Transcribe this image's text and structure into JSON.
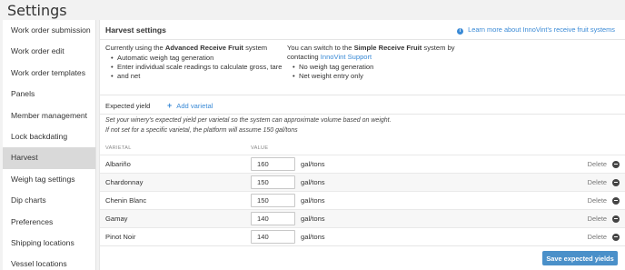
{
  "page_title": "Settings",
  "sidebar": {
    "items": [
      {
        "label": "Work order submission"
      },
      {
        "label": "Work order edit"
      },
      {
        "label": "Work order templates"
      },
      {
        "label": "Panels"
      },
      {
        "label": "Member management"
      },
      {
        "label": "Lock backdating"
      },
      {
        "label": "Harvest",
        "active": true
      },
      {
        "label": "Weigh tag settings"
      },
      {
        "label": "Dip charts"
      },
      {
        "label": "Preferences"
      },
      {
        "label": "Shipping locations"
      },
      {
        "label": "Vessel locations"
      }
    ]
  },
  "main": {
    "title": "Harvest settings",
    "learn_link": "Learn more about InnoVint's receive fruit systems",
    "current": {
      "prefix": "Currently using the ",
      "system": "Advanced Receive Fruit",
      "suffix": " system",
      "bullets": [
        "Automatic weigh tag generation",
        "Enter individual scale readings to calculate gross, tare",
        "and net"
      ]
    },
    "switch": {
      "prefix": "You can switch to the ",
      "system": "Simple Receive Fruit",
      "suffix": " system by",
      "line2_prefix": "contacting ",
      "support_link": "InnoVint Support",
      "bullets": [
        "No weigh tag generation",
        "Net weight entry only"
      ]
    },
    "expected_yield": "Expected yield",
    "add_varietal": "Add varietal",
    "add_icon": "+",
    "note_line1": "Set your winery's expected yield per varietal so the system can approximate volume based on weight.",
    "note_line2": "If not set for a specific varietal, the platform will assume 150 gal/tons",
    "col_varietal": "VARIETAL",
    "col_value": "VALUE",
    "rows": [
      {
        "name": "Albariño",
        "value": "160",
        "unit": "gal/tons",
        "delete": "Delete"
      },
      {
        "name": "Chardonnay",
        "value": "150",
        "unit": "gal/tons",
        "delete": "Delete"
      },
      {
        "name": "Chenin Blanc",
        "value": "150",
        "unit": "gal/tons",
        "delete": "Delete"
      },
      {
        "name": "Gamay",
        "value": "140",
        "unit": "gal/tons",
        "delete": "Delete"
      },
      {
        "name": "Pinot Noir",
        "value": "140",
        "unit": "gal/tons",
        "delete": "Delete"
      }
    ],
    "save_button": "Save expected yields"
  },
  "colors": {
    "accent": "#3a8ad6",
    "button": "#4a90c9",
    "active_item": "#d9d9d9"
  },
  "icons": {
    "info": "info-icon",
    "remove": "minus-circle-icon",
    "add": "plus-icon"
  }
}
